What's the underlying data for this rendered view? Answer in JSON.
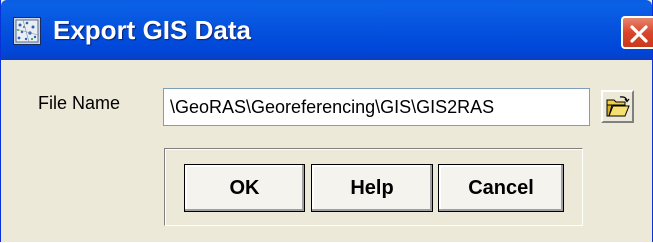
{
  "window": {
    "title": "Export GIS Data",
    "app_icon": "map-grid-icon",
    "close_icon": "close-icon"
  },
  "form": {
    "file_name_label": "File Name",
    "file_name_value": "\\GeoRAS\\Georeferencing\\GIS\\GIS2RAS",
    "browse_icon": "open-folder-icon"
  },
  "buttons": {
    "ok_label": "OK",
    "help_label": "Help",
    "cancel_label": "Cancel"
  },
  "colors": {
    "titlebar": "#0553de",
    "window_bg": "#ece9d8",
    "close_button": "#d9462a"
  }
}
